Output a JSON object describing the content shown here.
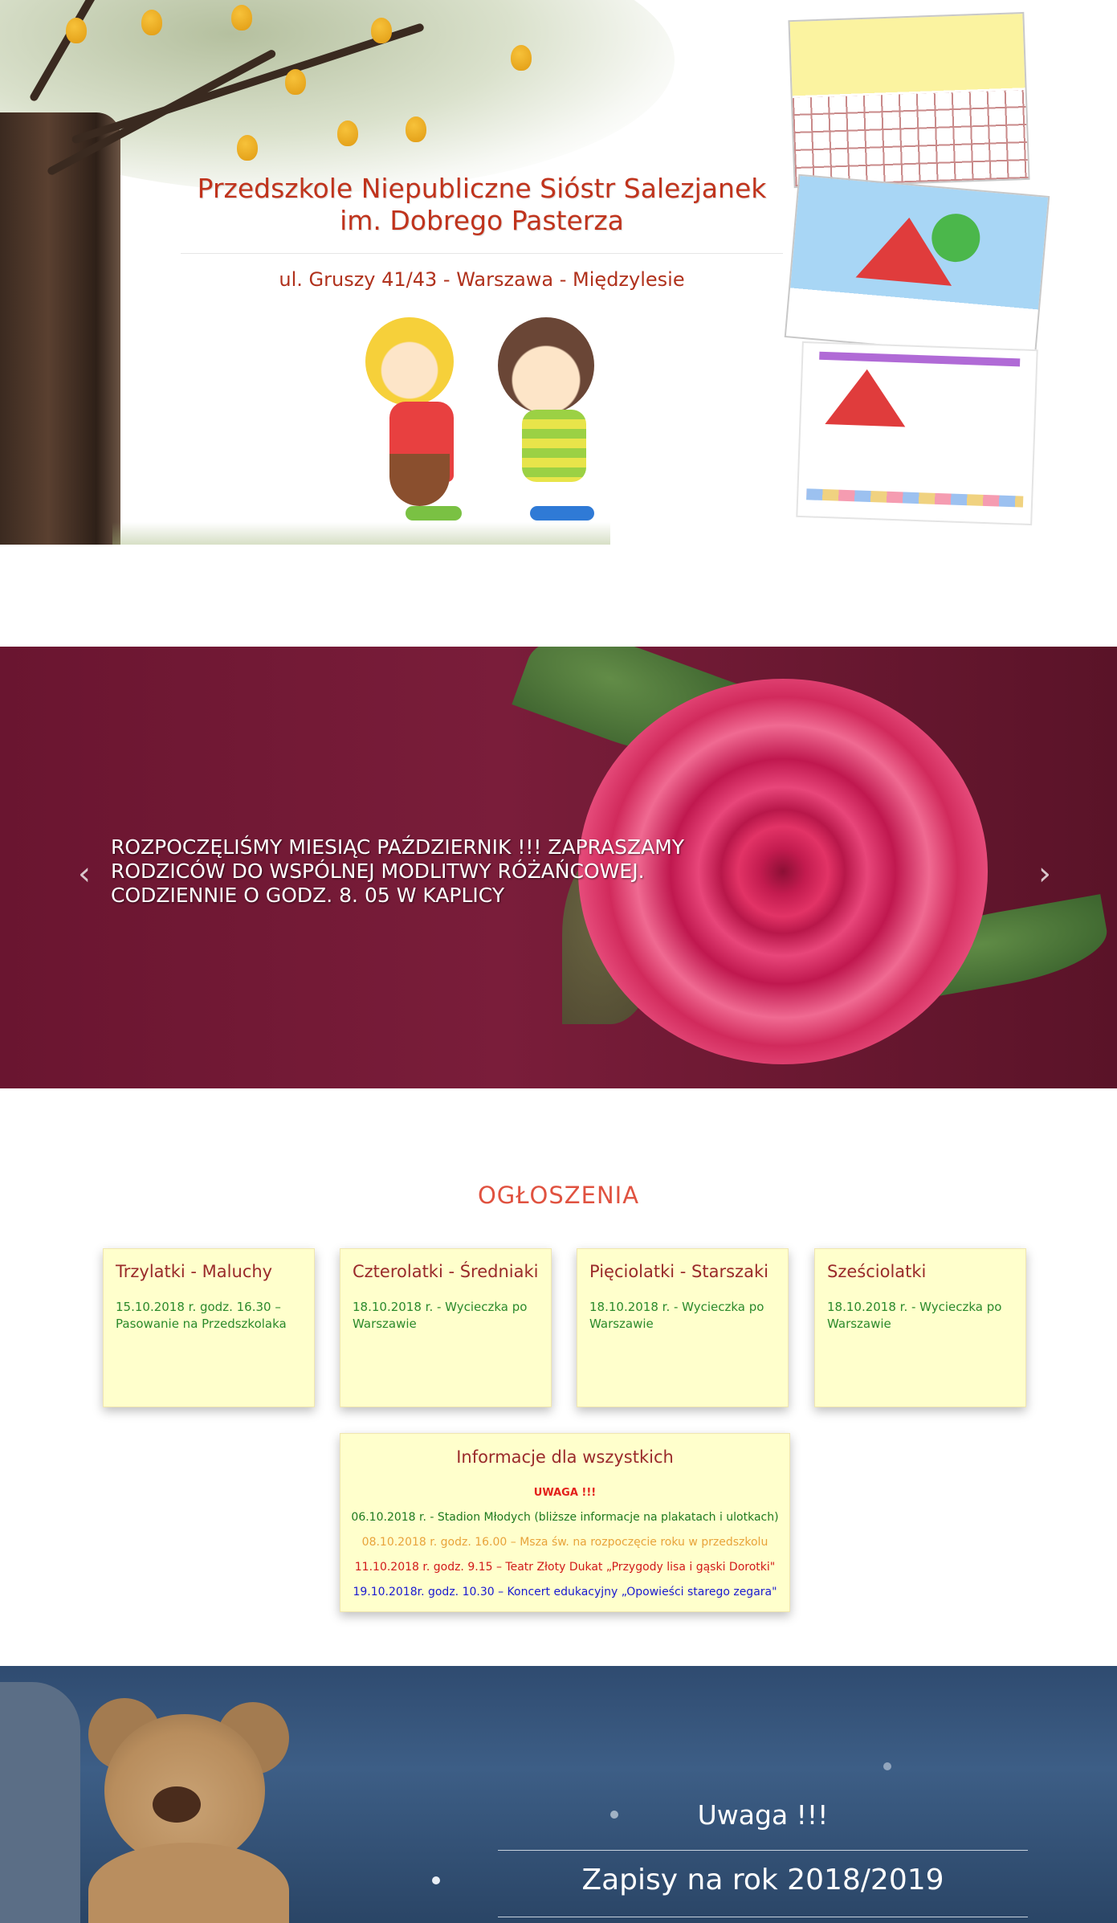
{
  "header": {
    "title_line1": "Przedszkole Niepubliczne Sióstr Salezjanek",
    "title_line2": "im. Dobrego Pasterza",
    "address": "ul. Gruszy 41/43 - Warszawa - Międzylesie"
  },
  "slider": {
    "caption": "ROZPOCZĘLIŚMY MIESIĄC PAŹDZIERNIK !!! ZAPRASZAMY RODZICÓW DO WSPÓLNEJ MODLITWY RÓŻAŃCOWEJ. CODZIENNIE O GODZ. 8. 05 W KAPLICY",
    "prev_icon": "‹",
    "next_icon": "›"
  },
  "announcements": {
    "heading": "OGŁOSZENIA",
    "cards": [
      {
        "title": "Trzylatki - Maluchy",
        "text": "15.10.2018 r. godz. 16.30 – Pasowanie na Przedszkolaka"
      },
      {
        "title": "Czterolatki - Średniaki",
        "text": "18.10.2018 r. - Wycieczka po Warszawie"
      },
      {
        "title": "Pięciolatki - Starszaki",
        "text": "18.10.2018 r. - Wycieczka po Warszawie"
      },
      {
        "title": "Sześciolatki",
        "text": "18.10.2018 r. - Wycieczka po Warszawie"
      }
    ],
    "info": {
      "title": "Informacje dla wszystkich",
      "lines": [
        {
          "text": "UWAGA !!!",
          "color": "#e3201b"
        },
        {
          "text": "06.10.2018 r. - Stadion Młodych (bliższe informacje na plakatach i ulotkach)",
          "color": "#1f7a1f"
        },
        {
          "text": "08.10.2018 r. godz. 16.00 – Msza św. na rozpoczęcie roku w przedszkolu",
          "color": "#e8a33a"
        },
        {
          "text": "11.10.2018 r. godz. 9.15 – Teatr Złoty Dukat „Przygody lisa i gąski Dorotki\"",
          "color": "#d11a1a"
        },
        {
          "text": "19.10.2018r. godz. 10.30 – Koncert edukacyjny „Opowieści starego zegara\"",
          "color": "#1a1ad1"
        }
      ]
    }
  },
  "bottom_banner": {
    "heading": "Uwaga !!!",
    "subheading": "Zapisy na rok 2018/2019"
  }
}
